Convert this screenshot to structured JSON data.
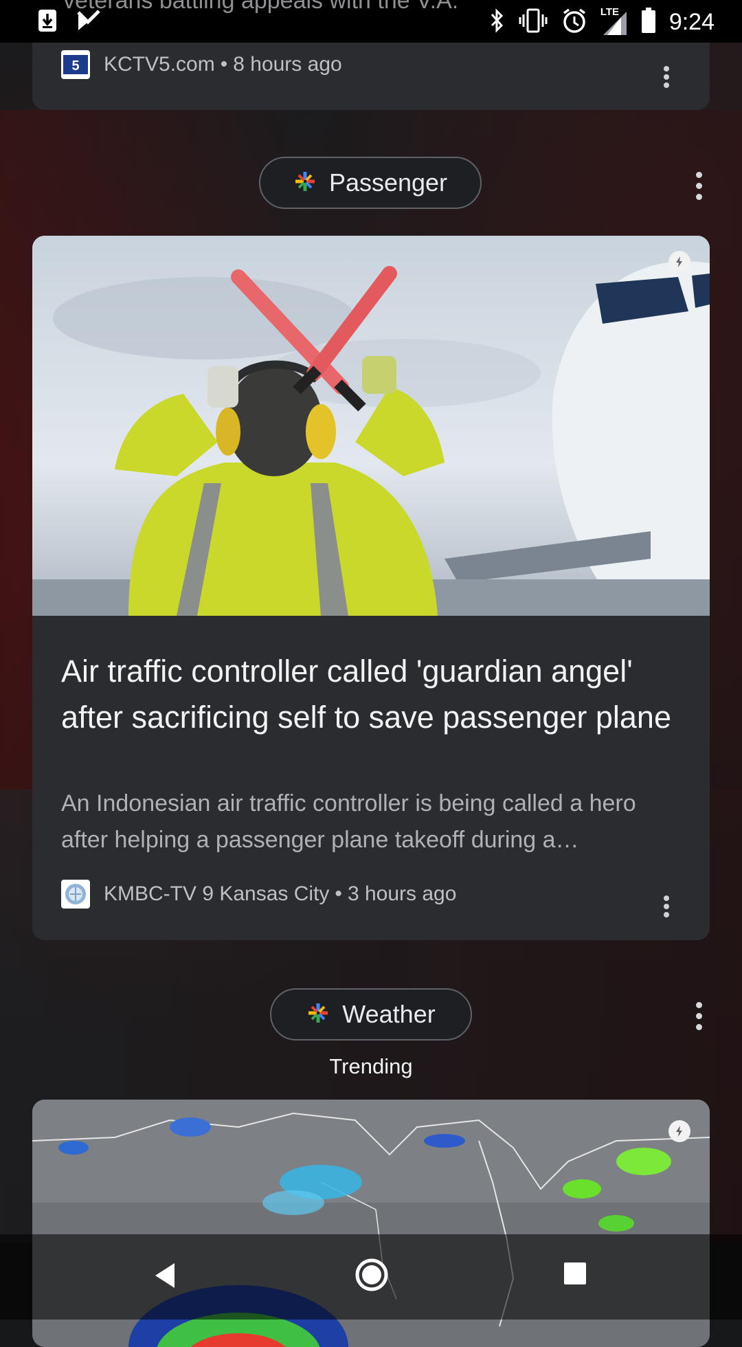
{
  "status_bar": {
    "time": "9:24",
    "network": "LTE",
    "peek_text": "veterans battling appeals with the V.A.",
    "icons": [
      "download-icon",
      "play-store-icon",
      "bluetooth-icon",
      "vibrate-icon",
      "alarm-icon",
      "signal-icon",
      "battery-icon"
    ]
  },
  "top_card": {
    "source_name": "KCTV5.com",
    "time_ago": "8 hours ago",
    "favicon": "kctv5-logo"
  },
  "passenger_section": {
    "topic_label": "Passenger",
    "article": {
      "headline": "Air traffic controller called 'guardian angel' after sacrificing self to save passenger plane",
      "snippet": "An Indonesian air traffic controller is being called a hero after helping a passenger plane takeoff during a…",
      "source_name": "KMBC-TV 9 Kansas City",
      "time_ago": "3 hours ago",
      "favicon": "kmbc-logo",
      "image": "ground-crew-marshalling-plane",
      "amp_badge": "amp-lightning-icon"
    }
  },
  "weather_section": {
    "topic_label": "Weather",
    "subtitle": "Trending",
    "image": "satellite-weather-map",
    "amp_badge": "amp-lightning-icon"
  },
  "nav_bar": {
    "icons": [
      "back-icon",
      "home-icon",
      "recents-icon"
    ]
  },
  "colors": {
    "card": "#2b2c30",
    "background": "#17181a",
    "text_primary": "#f1f3f4",
    "text_secondary": "#bdc1c6"
  }
}
